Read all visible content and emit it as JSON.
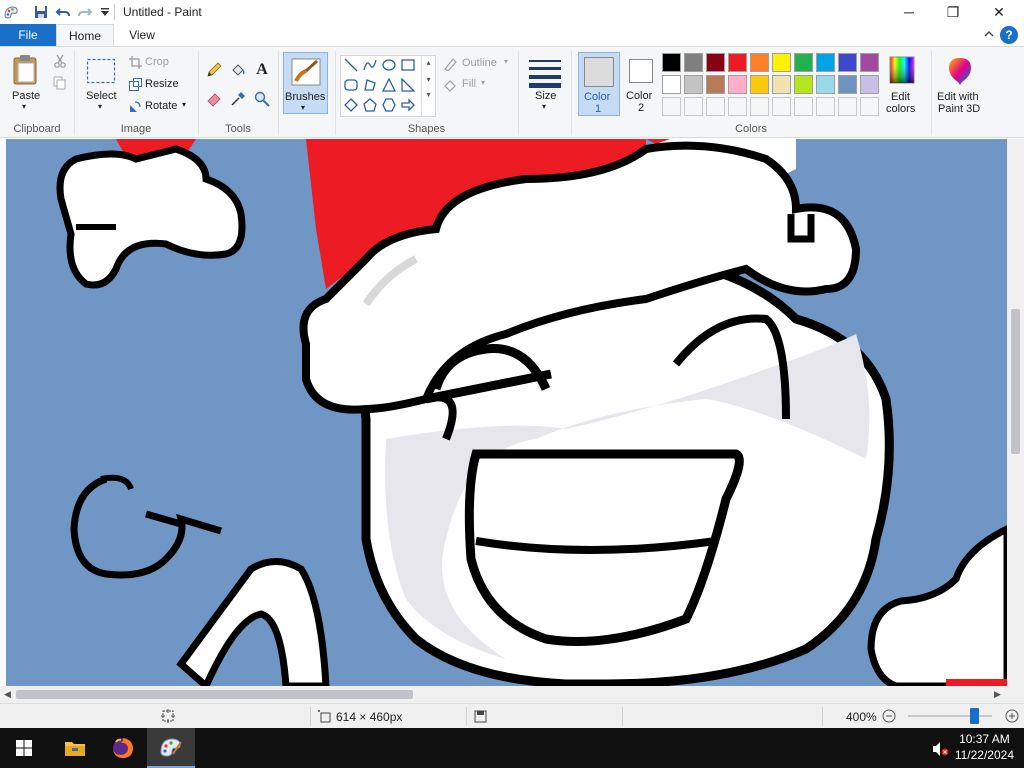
{
  "window": {
    "title": "Untitled - Paint",
    "minimize_glyph": "─",
    "maximize_glyph": "❐",
    "close_glyph": "✕"
  },
  "tabs": {
    "file": "File",
    "home": "Home",
    "view": "View",
    "help": "?"
  },
  "ribbon": {
    "clipboard": {
      "paste": "Paste",
      "group": "Clipboard"
    },
    "image": {
      "select": "Select",
      "crop": "Crop",
      "resize": "Resize",
      "rotate": "Rotate",
      "group": "Image"
    },
    "tools": {
      "group": "Tools",
      "text_glyph": "A"
    },
    "brushes": {
      "label": "Brushes"
    },
    "shapes": {
      "outline": "Outline",
      "fill": "Fill",
      "group": "Shapes"
    },
    "size": {
      "label": "Size"
    },
    "colors": {
      "color1": "Color",
      "color1_num": "1",
      "color2": "Color",
      "color2_num": "2",
      "edit_colors_line1": "Edit",
      "edit_colors_line2": "colors",
      "group": "Colors",
      "color1_value": "#dcdcdc",
      "color2_value": "#ffffff",
      "row1": [
        "#000000",
        "#7f7f7f",
        "#880015",
        "#ed1c24",
        "#ff7f27",
        "#fff200",
        "#22b14c",
        "#00a2e8",
        "#3f48cc",
        "#a349a4"
      ],
      "row2": [
        "#ffffff",
        "#c3c3c3",
        "#b97a57",
        "#ffaec9",
        "#ffc90e",
        "#efe4b0",
        "#b5e61d",
        "#99d9ea",
        "#7092be",
        "#c8bfe7"
      ]
    },
    "paint3d": {
      "line1": "Edit with",
      "line2": "Paint 3D"
    }
  },
  "statusbar": {
    "dimensions": "614 × 460px",
    "zoom": "400%",
    "zoom_level": 0.78
  },
  "taskbar": {
    "time": "10:37 AM",
    "date": "11/22/2024"
  },
  "canvas": {
    "background": "#6f96c4"
  }
}
